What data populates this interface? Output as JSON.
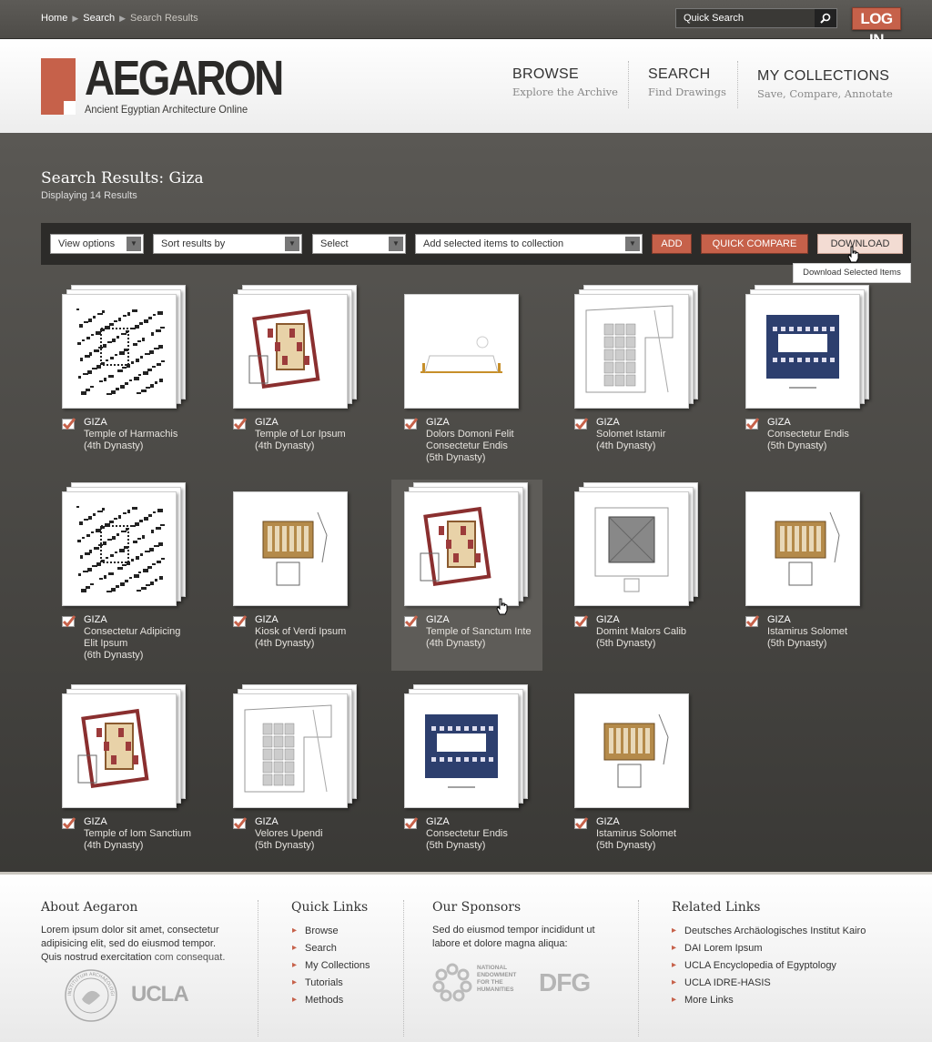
{
  "breadcrumb": {
    "home": "Home",
    "search": "Search",
    "current": "Search Results"
  },
  "quick_search": {
    "placeholder": "Quick Search"
  },
  "login_label": "LOG IN",
  "logo": {
    "word": "AEGARON",
    "tagline": "Ancient Egyptian Architecture Online"
  },
  "nav": [
    {
      "title": "BROWSE",
      "sub": "Explore the Archive"
    },
    {
      "title": "SEARCH",
      "sub": "Find Drawings"
    },
    {
      "title": "MY COLLECTIONS",
      "sub": "Save, Compare, Annotate"
    }
  ],
  "results": {
    "title": "Search Results: Giza",
    "count": "Displaying 14 Results"
  },
  "toolbar": {
    "view": "View options",
    "sort": "Sort results by",
    "select": "Select",
    "collection": "Add selected items to collection",
    "add": "ADD",
    "compare": "QUICK COMPARE",
    "download": "DOWNLOAD",
    "tooltip": "Download Selected Items"
  },
  "items": [
    {
      "site": "GIZA",
      "lines": [
        "Temple of Harmachis",
        "(4th Dynasty)"
      ]
    },
    {
      "site": "GIZA",
      "lines": [
        "Temple of Lor Ipsum",
        "(4th Dynasty)"
      ]
    },
    {
      "site": "GIZA",
      "lines": [
        "Dolors Domoni Felit",
        "Consectetur Endis",
        "(5th Dynasty)"
      ]
    },
    {
      "site": "GIZA",
      "lines": [
        "Solomet Istamir",
        "(4th Dynasty)"
      ]
    },
    {
      "site": "GIZA",
      "lines": [
        "Consectetur Endis",
        "(5th Dynasty)"
      ]
    },
    {
      "site": "GIZA",
      "lines": [
        "Consectetur Adipicing",
        "Elit Ipsum",
        "(6th Dynasty)"
      ]
    },
    {
      "site": "GIZA",
      "lines": [
        "Kiosk of Verdi Ipsum",
        "(4th Dynasty)"
      ]
    },
    {
      "site": "GIZA",
      "lines": [
        "Temple of Sanctum Inte",
        "(4th Dynasty)"
      ]
    },
    {
      "site": "GIZA",
      "lines": [
        "Domint Malors Calib",
        "(5th Dynasty)"
      ]
    },
    {
      "site": "GIZA",
      "lines": [
        "Istamirus Solomet",
        "(5th Dynasty)"
      ]
    },
    {
      "site": "GIZA",
      "lines": [
        "Temple of Iom Sanctium",
        "(4th Dynasty)"
      ]
    },
    {
      "site": "GIZA",
      "lines": [
        "Velores Upendi",
        "(5th Dynasty)"
      ]
    },
    {
      "site": "GIZA",
      "lines": [
        "Consectetur Endis",
        "(5th Dynasty)"
      ]
    },
    {
      "site": "GIZA",
      "lines": [
        "Istamirus Solomet",
        "(5th Dynasty)"
      ]
    }
  ],
  "footer": {
    "about": {
      "title": "About Aegaron",
      "text": "Lorem ipsum dolor sit amet, consectetur adipisicing elit, sed do eiusmod tempor. Quis nostrud exercitation",
      "link": "com consequat.",
      "ucla": "UCLA",
      "seal_text": "INSTITUTUM ARCHAEOLOGICUM GERMANICUM"
    },
    "quick": {
      "title": "Quick Links",
      "links": [
        "Browse",
        "Search",
        "My Collections",
        "Tutorials",
        "Methods"
      ]
    },
    "sponsors": {
      "title": "Our Sponsors",
      "text": "Sed do eiusmod tempor incididunt ut labore et dolore magna aliqua:",
      "neh": "NATIONAL ENDOWMENT FOR THE HUMANITIES",
      "dfg": "DFG"
    },
    "related": {
      "title": "Related Links",
      "links": [
        "Deutsches Archäologisches Institut Kairo",
        "DAI Lorem Ipsum",
        "UCLA Encyclopedia of Egyptology",
        "UCLA IDRE-HASIS",
        "More Links"
      ]
    }
  }
}
